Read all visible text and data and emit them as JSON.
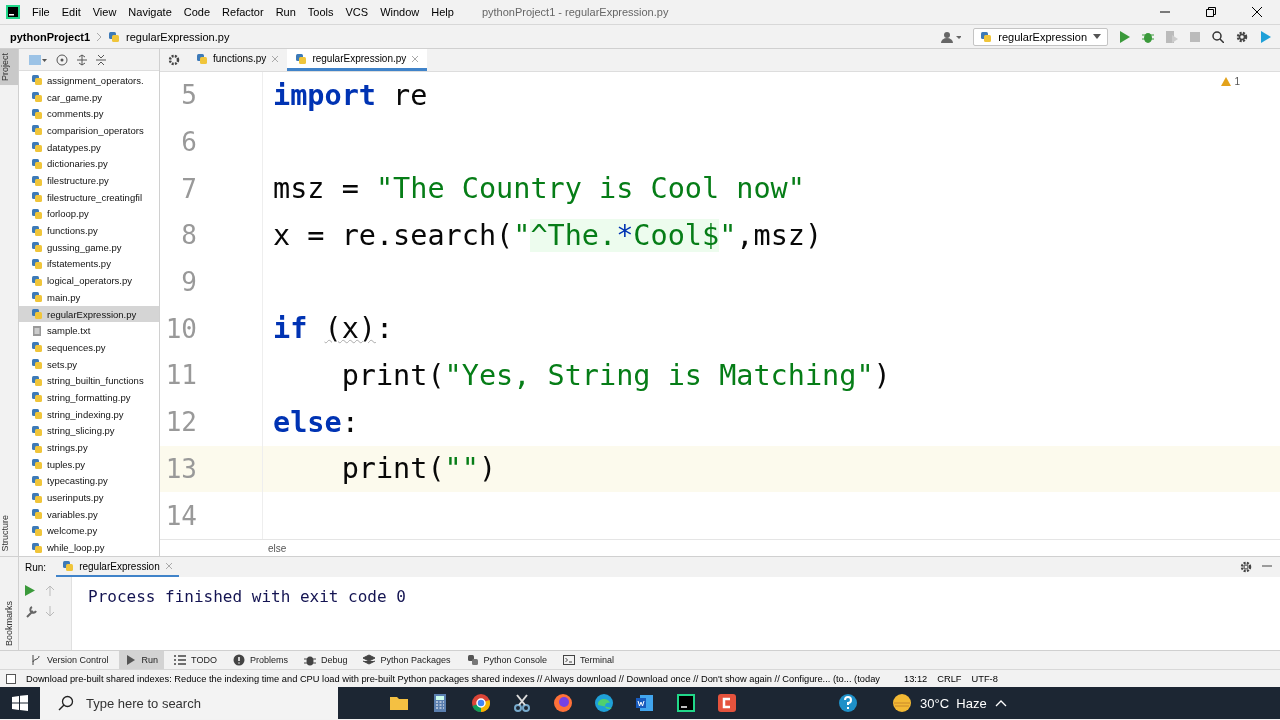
{
  "menu": [
    "File",
    "Edit",
    "View",
    "Navigate",
    "Code",
    "Refactor",
    "Run",
    "Tools",
    "VCS",
    "Window",
    "Help"
  ],
  "window_title": "pythonProject1 - regularExpression.py",
  "breadcrumb": {
    "project": "pythonProject1",
    "file": "regularExpression.py"
  },
  "run_config": "regularExpression",
  "editor_tabs": [
    {
      "label": "functions.py",
      "selected": false
    },
    {
      "label": "regularExpression.py",
      "selected": true
    }
  ],
  "side_stripe": {
    "top": "Project",
    "middle": "Structure",
    "bottom": "Bookmarks"
  },
  "project_files": [
    {
      "label": "assignment_operators.",
      "kind": "python",
      "selected": false
    },
    {
      "label": "car_game.py",
      "kind": "python",
      "selected": false
    },
    {
      "label": "comments.py",
      "kind": "python",
      "selected": false
    },
    {
      "label": "comparision_operators",
      "kind": "python",
      "selected": false
    },
    {
      "label": "datatypes.py",
      "kind": "python",
      "selected": false
    },
    {
      "label": "dictionaries.py",
      "kind": "python",
      "selected": false
    },
    {
      "label": "filestructure.py",
      "kind": "python",
      "selected": false
    },
    {
      "label": "filestructure_creatingfil",
      "kind": "python",
      "selected": false
    },
    {
      "label": "forloop.py",
      "kind": "python",
      "selected": false
    },
    {
      "label": "functions.py",
      "kind": "python",
      "selected": false
    },
    {
      "label": "gussing_game.py",
      "kind": "python",
      "selected": false
    },
    {
      "label": "ifstatements.py",
      "kind": "python",
      "selected": false
    },
    {
      "label": "logical_operators.py",
      "kind": "python",
      "selected": false
    },
    {
      "label": "main.py",
      "kind": "python",
      "selected": false
    },
    {
      "label": "regularExpression.py",
      "kind": "python",
      "selected": true
    },
    {
      "label": "sample.txt",
      "kind": "text",
      "selected": false
    },
    {
      "label": "sequences.py",
      "kind": "python",
      "selected": false
    },
    {
      "label": "sets.py",
      "kind": "python",
      "selected": false
    },
    {
      "label": "string_builtin_functions",
      "kind": "python",
      "selected": false
    },
    {
      "label": "string_formatting.py",
      "kind": "python",
      "selected": false
    },
    {
      "label": "string_indexing.py",
      "kind": "python",
      "selected": false
    },
    {
      "label": "string_slicing.py",
      "kind": "python",
      "selected": false
    },
    {
      "label": "strings.py",
      "kind": "python",
      "selected": false
    },
    {
      "label": "tuples.py",
      "kind": "python",
      "selected": false
    },
    {
      "label": "typecasting.py",
      "kind": "python",
      "selected": false
    },
    {
      "label": "userinputs.py",
      "kind": "python",
      "selected": false
    },
    {
      "label": "variables.py",
      "kind": "python",
      "selected": false
    },
    {
      "label": "welcome.py",
      "kind": "python",
      "selected": false
    },
    {
      "label": "while_loop.py",
      "kind": "python",
      "selected": false
    }
  ],
  "editor": {
    "warnings": "1",
    "breadcrumb": "else",
    "lines": [
      {
        "number": "5",
        "current": false,
        "tokens": [
          {
            "text": "import",
            "kind": "keyword"
          },
          {
            "text": " re",
            "kind": "plain"
          }
        ]
      },
      {
        "number": "6",
        "current": false
      },
      {
        "number": "7",
        "current": false,
        "tokens": [
          {
            "text": "msz = ",
            "kind": "plain"
          },
          {
            "text": "\"The Country is Cool now\"",
            "kind": "string"
          }
        ]
      },
      {
        "number": "8",
        "current": false,
        "tokens": [
          {
            "text": "x = re.search(",
            "kind": "plain"
          },
          {
            "text": "\"",
            "kind": "string"
          },
          {
            "text": "^The.",
            "kind": "regex"
          },
          {
            "text": "*",
            "kind": "regex_op"
          },
          {
            "text": "Cool$",
            "kind": "regex"
          },
          {
            "text": "\"",
            "kind": "string"
          },
          {
            "text": ",msz)",
            "kind": "plain"
          }
        ]
      },
      {
        "number": "9",
        "current": false
      },
      {
        "number": "10",
        "current": false,
        "tokens": [
          {
            "text": "if ",
            "kind": "keyword"
          },
          {
            "text": "(x)",
            "kind": "weak"
          },
          {
            "text": ":",
            "kind": "plain"
          }
        ]
      },
      {
        "number": "11",
        "current": false,
        "tokens": [
          {
            "text": "    print(",
            "kind": "plain"
          },
          {
            "text": "\"Yes, String is Matching\"",
            "kind": "string"
          },
          {
            "text": ")",
            "kind": "plain"
          }
        ]
      },
      {
        "number": "12",
        "current": false,
        "tokens": [
          {
            "text": "else",
            "kind": "keyword"
          },
          {
            "text": ":",
            "kind": "plain"
          }
        ]
      },
      {
        "number": "13",
        "current": true,
        "tokens": [
          {
            "text": "    print(",
            "kind": "plain"
          },
          {
            "text": "\"\"",
            "kind": "string"
          },
          {
            "text": ")",
            "kind": "plain"
          }
        ]
      },
      {
        "number": "14",
        "current": false
      }
    ]
  },
  "run": {
    "label": "Run:",
    "tab": "regularExpression",
    "output": "Process finished with exit code 0"
  },
  "tool_tabs": [
    {
      "label": "Version Control",
      "kind": "branch",
      "selected": false
    },
    {
      "label": "Run",
      "kind": "play",
      "selected": true
    },
    {
      "label": "TODO",
      "kind": "list",
      "selected": false
    },
    {
      "label": "Problems",
      "kind": "alert",
      "selected": false
    },
    {
      "label": "Debug",
      "kind": "bug",
      "selected": false
    },
    {
      "label": "Python Packages",
      "kind": "layers",
      "selected": false
    },
    {
      "label": "Python Console",
      "kind": "python",
      "selected": false
    },
    {
      "label": "Terminal",
      "kind": "terminal",
      "selected": false
    }
  ],
  "status": {
    "message": "Download pre-built shared indexes: Reduce the indexing time and CPU load with pre-built Python packages shared indexes // Always download // Download once // Don't show again // Configure... (to... (today",
    "position": "13:12",
    "line_separator": "CRLF",
    "encoding": "UTF-8"
  },
  "taskbar": {
    "search_placeholder": "Type here to search",
    "apps": [
      {
        "kind": "folder"
      },
      {
        "kind": "calculator"
      },
      {
        "kind": "chrome"
      },
      {
        "kind": "snip"
      },
      {
        "kind": "firefox"
      },
      {
        "kind": "edge"
      },
      {
        "kind": "word"
      },
      {
        "kind": "pycharm"
      },
      {
        "kind": "camtasia"
      }
    ],
    "weather": "30°C  Haze"
  }
}
